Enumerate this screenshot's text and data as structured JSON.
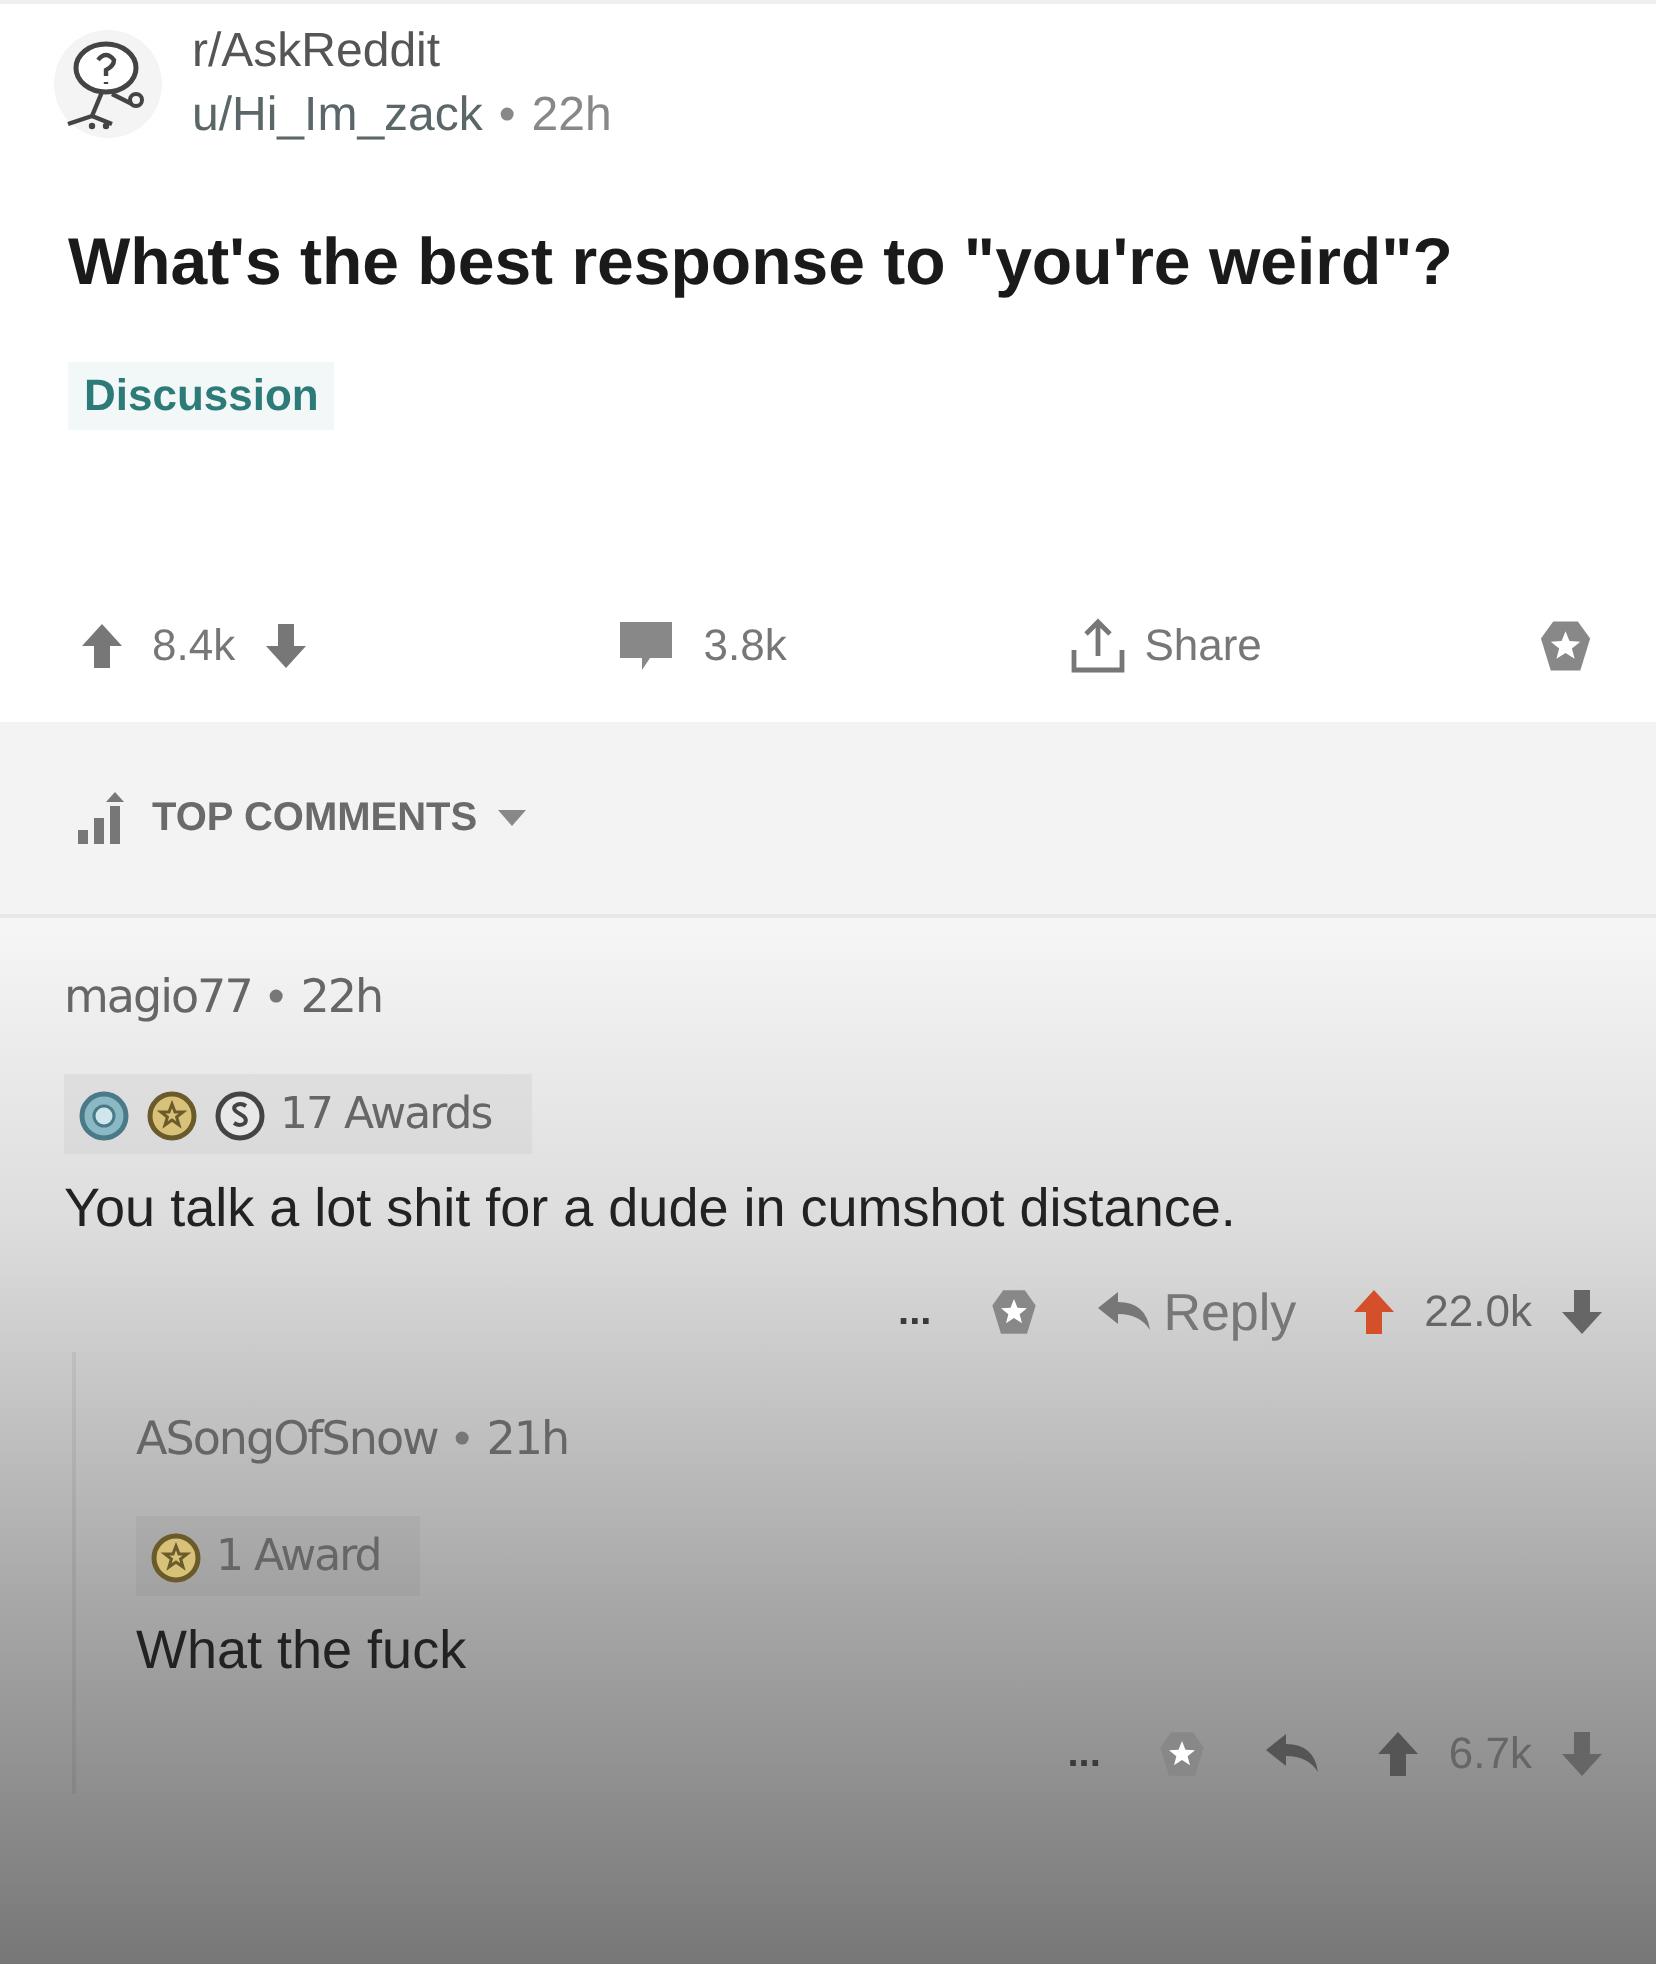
{
  "post": {
    "subreddit": "r/AskReddit",
    "author": "u/Hi_Im_zack",
    "age": "22h",
    "separator": "•",
    "title": "What's the best response to \"you're weird\"?",
    "flair": "Discussion",
    "score": "8.4k",
    "comments": "3.8k",
    "share": "Share"
  },
  "sort": {
    "label": "TOP COMMENTS"
  },
  "comments": [
    {
      "author": "magio77",
      "age": "22h",
      "separator": "•",
      "awards": [
        {
          "kind": "platinum"
        },
        {
          "kind": "gold"
        },
        {
          "kind": "silver"
        }
      ],
      "awards_label": "17 Awards",
      "body": "You talk a lot shit for a dude in cumshot distance.",
      "more": "...",
      "reply": "Reply",
      "score": "22.0k",
      "upvoted": true,
      "replies": [
        {
          "author": "ASongOfSnow",
          "age": "21h",
          "separator": "•",
          "awards": [
            {
              "kind": "gold"
            }
          ],
          "awards_label": "1 Award",
          "body": "What the fuck",
          "more": "...",
          "score": "6.7k",
          "upvoted": false
        }
      ]
    }
  ]
}
